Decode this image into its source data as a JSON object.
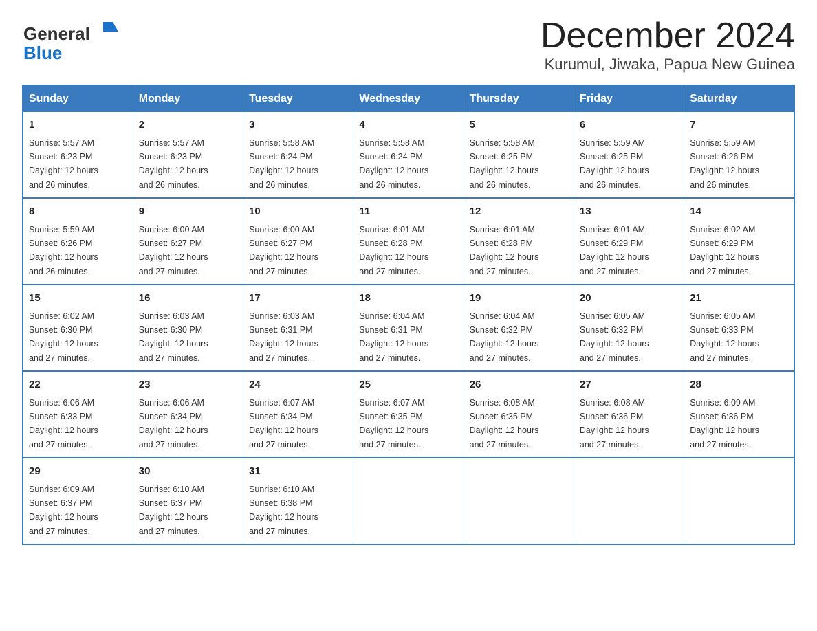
{
  "logo": {
    "general": "General",
    "blue": "Blue"
  },
  "title": "December 2024",
  "subtitle": "Kurumul, Jiwaka, Papua New Guinea",
  "days_of_week": [
    "Sunday",
    "Monday",
    "Tuesday",
    "Wednesday",
    "Thursday",
    "Friday",
    "Saturday"
  ],
  "weeks": [
    [
      {
        "day": "1",
        "sunrise": "5:57 AM",
        "sunset": "6:23 PM",
        "daylight": "12 hours and 26 minutes."
      },
      {
        "day": "2",
        "sunrise": "5:57 AM",
        "sunset": "6:23 PM",
        "daylight": "12 hours and 26 minutes."
      },
      {
        "day": "3",
        "sunrise": "5:58 AM",
        "sunset": "6:24 PM",
        "daylight": "12 hours and 26 minutes."
      },
      {
        "day": "4",
        "sunrise": "5:58 AM",
        "sunset": "6:24 PM",
        "daylight": "12 hours and 26 minutes."
      },
      {
        "day": "5",
        "sunrise": "5:58 AM",
        "sunset": "6:25 PM",
        "daylight": "12 hours and 26 minutes."
      },
      {
        "day": "6",
        "sunrise": "5:59 AM",
        "sunset": "6:25 PM",
        "daylight": "12 hours and 26 minutes."
      },
      {
        "day": "7",
        "sunrise": "5:59 AM",
        "sunset": "6:26 PM",
        "daylight": "12 hours and 26 minutes."
      }
    ],
    [
      {
        "day": "8",
        "sunrise": "5:59 AM",
        "sunset": "6:26 PM",
        "daylight": "12 hours and 26 minutes."
      },
      {
        "day": "9",
        "sunrise": "6:00 AM",
        "sunset": "6:27 PM",
        "daylight": "12 hours and 27 minutes."
      },
      {
        "day": "10",
        "sunrise": "6:00 AM",
        "sunset": "6:27 PM",
        "daylight": "12 hours and 27 minutes."
      },
      {
        "day": "11",
        "sunrise": "6:01 AM",
        "sunset": "6:28 PM",
        "daylight": "12 hours and 27 minutes."
      },
      {
        "day": "12",
        "sunrise": "6:01 AM",
        "sunset": "6:28 PM",
        "daylight": "12 hours and 27 minutes."
      },
      {
        "day": "13",
        "sunrise": "6:01 AM",
        "sunset": "6:29 PM",
        "daylight": "12 hours and 27 minutes."
      },
      {
        "day": "14",
        "sunrise": "6:02 AM",
        "sunset": "6:29 PM",
        "daylight": "12 hours and 27 minutes."
      }
    ],
    [
      {
        "day": "15",
        "sunrise": "6:02 AM",
        "sunset": "6:30 PM",
        "daylight": "12 hours and 27 minutes."
      },
      {
        "day": "16",
        "sunrise": "6:03 AM",
        "sunset": "6:30 PM",
        "daylight": "12 hours and 27 minutes."
      },
      {
        "day": "17",
        "sunrise": "6:03 AM",
        "sunset": "6:31 PM",
        "daylight": "12 hours and 27 minutes."
      },
      {
        "day": "18",
        "sunrise": "6:04 AM",
        "sunset": "6:31 PM",
        "daylight": "12 hours and 27 minutes."
      },
      {
        "day": "19",
        "sunrise": "6:04 AM",
        "sunset": "6:32 PM",
        "daylight": "12 hours and 27 minutes."
      },
      {
        "day": "20",
        "sunrise": "6:05 AM",
        "sunset": "6:32 PM",
        "daylight": "12 hours and 27 minutes."
      },
      {
        "day": "21",
        "sunrise": "6:05 AM",
        "sunset": "6:33 PM",
        "daylight": "12 hours and 27 minutes."
      }
    ],
    [
      {
        "day": "22",
        "sunrise": "6:06 AM",
        "sunset": "6:33 PM",
        "daylight": "12 hours and 27 minutes."
      },
      {
        "day": "23",
        "sunrise": "6:06 AM",
        "sunset": "6:34 PM",
        "daylight": "12 hours and 27 minutes."
      },
      {
        "day": "24",
        "sunrise": "6:07 AM",
        "sunset": "6:34 PM",
        "daylight": "12 hours and 27 minutes."
      },
      {
        "day": "25",
        "sunrise": "6:07 AM",
        "sunset": "6:35 PM",
        "daylight": "12 hours and 27 minutes."
      },
      {
        "day": "26",
        "sunrise": "6:08 AM",
        "sunset": "6:35 PM",
        "daylight": "12 hours and 27 minutes."
      },
      {
        "day": "27",
        "sunrise": "6:08 AM",
        "sunset": "6:36 PM",
        "daylight": "12 hours and 27 minutes."
      },
      {
        "day": "28",
        "sunrise": "6:09 AM",
        "sunset": "6:36 PM",
        "daylight": "12 hours and 27 minutes."
      }
    ],
    [
      {
        "day": "29",
        "sunrise": "6:09 AM",
        "sunset": "6:37 PM",
        "daylight": "12 hours and 27 minutes."
      },
      {
        "day": "30",
        "sunrise": "6:10 AM",
        "sunset": "6:37 PM",
        "daylight": "12 hours and 27 minutes."
      },
      {
        "day": "31",
        "sunrise": "6:10 AM",
        "sunset": "6:38 PM",
        "daylight": "12 hours and 27 minutes."
      },
      null,
      null,
      null,
      null
    ]
  ],
  "labels": {
    "sunrise": "Sunrise:",
    "sunset": "Sunset:",
    "daylight": "Daylight:"
  },
  "colors": {
    "header_bg": "#3a7abf",
    "header_text": "#ffffff",
    "border": "#3a7abf",
    "cell_border": "#c0d8ef"
  }
}
